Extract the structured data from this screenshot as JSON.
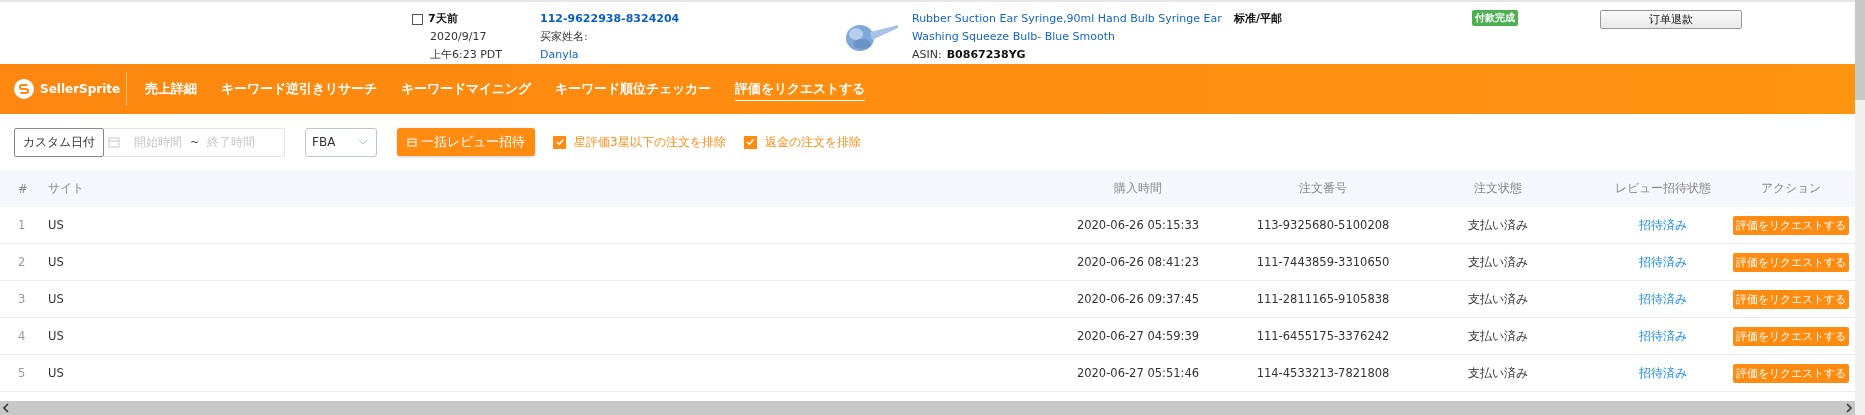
{
  "order_card": {
    "checked": false,
    "relative_time": "7天前",
    "date": "2020/9/17",
    "time": "上午6:23 PDT",
    "order_number": "112-9622938-8324204",
    "buyer_label": "买家姓名:",
    "buyer_name": "Danyla",
    "product_title": "Rubber Suction Ear Syringe,90ml Hand Bulb Syringe Ear Washing Squeeze Bulb- Blue Smooth",
    "shipping": "标准/平邮",
    "asin_label": "ASIN:",
    "asin": "B0867238YG",
    "status_badge": "付款完成",
    "refund_button": "订单退款"
  },
  "nav": {
    "brand": "SellerSprite",
    "items": [
      {
        "label": "売上詳細",
        "selected": false
      },
      {
        "label": "キーワード逆引きリサーチ",
        "selected": false
      },
      {
        "label": "キーワードマイニング",
        "selected": false
      },
      {
        "label": "キーワード順位チェッカー",
        "selected": false
      },
      {
        "label": "評価をリクエストする",
        "selected": true
      }
    ]
  },
  "filters": {
    "date_type": "カスタム日付",
    "start_placeholder": "開始時間",
    "separator": "~",
    "end_placeholder": "終了時間",
    "fulfillment": "FBA",
    "bulk_button": "一括レビュー招待",
    "checkboxes": [
      {
        "label": "星評価3星以下の注文を排除",
        "checked": true
      },
      {
        "label": "返金の注文を排除",
        "checked": true
      }
    ]
  },
  "table": {
    "columns": [
      "#",
      "サイト",
      "購入時間",
      "注文番号",
      "注文状態",
      "レビュー招待状態",
      "アクション"
    ],
    "rows": [
      {
        "index": "1",
        "site": "US",
        "purchase_time": "2020-06-26 05:15:33",
        "order_number": "113-9325680-5100208",
        "order_status": "支払い済み",
        "invite_status": "招待済み",
        "action": "評価をリクエストする"
      },
      {
        "index": "2",
        "site": "US",
        "purchase_time": "2020-06-26 08:41:23",
        "order_number": "111-7443859-3310650",
        "order_status": "支払い済み",
        "invite_status": "招待済み",
        "action": "評価をリクエストする"
      },
      {
        "index": "3",
        "site": "US",
        "purchase_time": "2020-06-26 09:37:45",
        "order_number": "111-2811165-9105838",
        "order_status": "支払い済み",
        "invite_status": "招待済み",
        "action": "評価をリクエストする"
      },
      {
        "index": "4",
        "site": "US",
        "purchase_time": "2020-06-27 04:59:39",
        "order_number": "111-6455175-3376242",
        "order_status": "支払い済み",
        "invite_status": "招待済み",
        "action": "評価をリクエストする"
      },
      {
        "index": "5",
        "site": "US",
        "purchase_time": "2020-06-27 05:51:46",
        "order_number": "114-4533213-7821808",
        "order_status": "支払い済み",
        "invite_status": "招待済み",
        "action": "評価をリクエストする"
      }
    ]
  }
}
